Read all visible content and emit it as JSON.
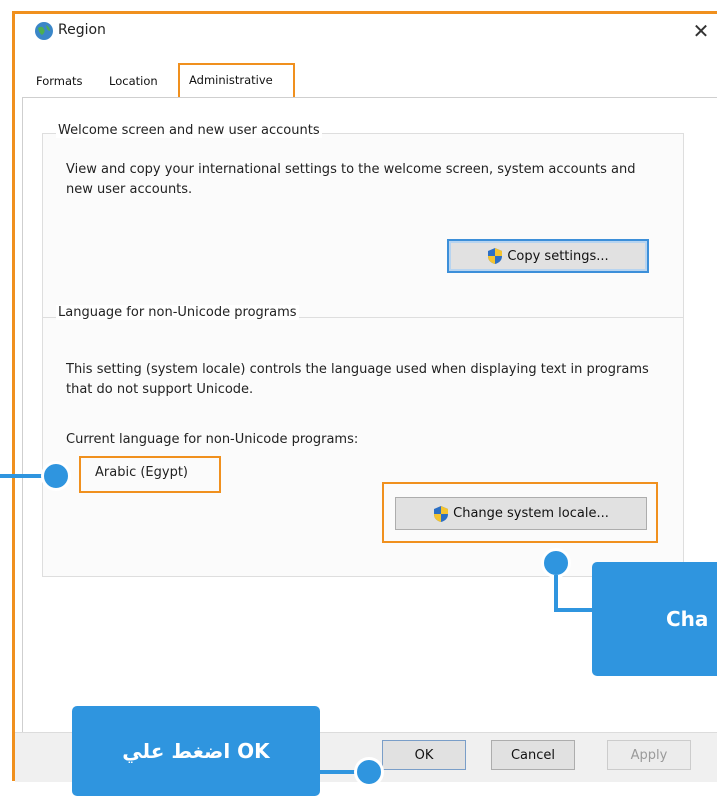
{
  "window": {
    "title": "Region",
    "close_glyph": "✕"
  },
  "tabs": [
    {
      "label": "Formats"
    },
    {
      "label": "Location"
    },
    {
      "label": "Administrative"
    }
  ],
  "welcome_group": {
    "title": "Welcome screen and new user accounts",
    "description": "View and copy your international settings to the welcome screen, system accounts and new user accounts.",
    "copy_button_label": "Copy settings..."
  },
  "language_group": {
    "title": "Language for non-Unicode programs",
    "description": "This setting (system locale) controls the language used when displaying text in programs that do not support Unicode.",
    "current_label": "Current language for non-Unicode programs:",
    "current_value": "Arabic (Egypt)",
    "change_button_label": "Change system locale..."
  },
  "footer": {
    "ok_label": "OK",
    "cancel_label": "Cancel",
    "apply_label": "Apply"
  },
  "callouts": {
    "right_text": "Cha",
    "ok_text": "اضغط علي OK"
  },
  "colors": {
    "highlight_orange": "#f0901e",
    "callout_blue": "#2f95df"
  },
  "icons": [
    "globe-region-icon",
    "close-icon",
    "shield-icon"
  ]
}
